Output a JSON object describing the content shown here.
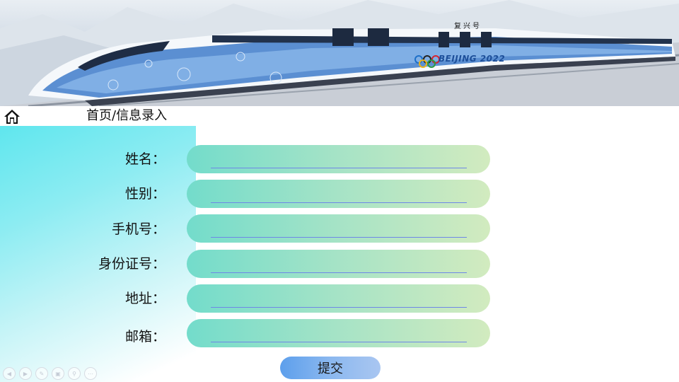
{
  "banner": {
    "olympic_text": "BEIJING 2022",
    "train_characters": "复兴号"
  },
  "breadcrumb": "首页/信息录入",
  "form": {
    "fields": [
      {
        "label": "姓名：",
        "value": ""
      },
      {
        "label": "性别：",
        "value": ""
      },
      {
        "label": "手机号：",
        "value": ""
      },
      {
        "label": "身份证号：",
        "value": ""
      },
      {
        "label": "地址：",
        "value": ""
      },
      {
        "label": "邮箱：",
        "value": ""
      }
    ],
    "submit_label": "提交"
  },
  "toolbar": {
    "icons": [
      "previous-icon",
      "next-icon",
      "pen-icon",
      "slides-icon",
      "zoom-icon",
      "more-icon"
    ]
  },
  "colors": {
    "field_start": "#73dccb",
    "field_end": "#d2ebbf",
    "panel": "#5fe6ee",
    "submit": "#5d9fec"
  }
}
